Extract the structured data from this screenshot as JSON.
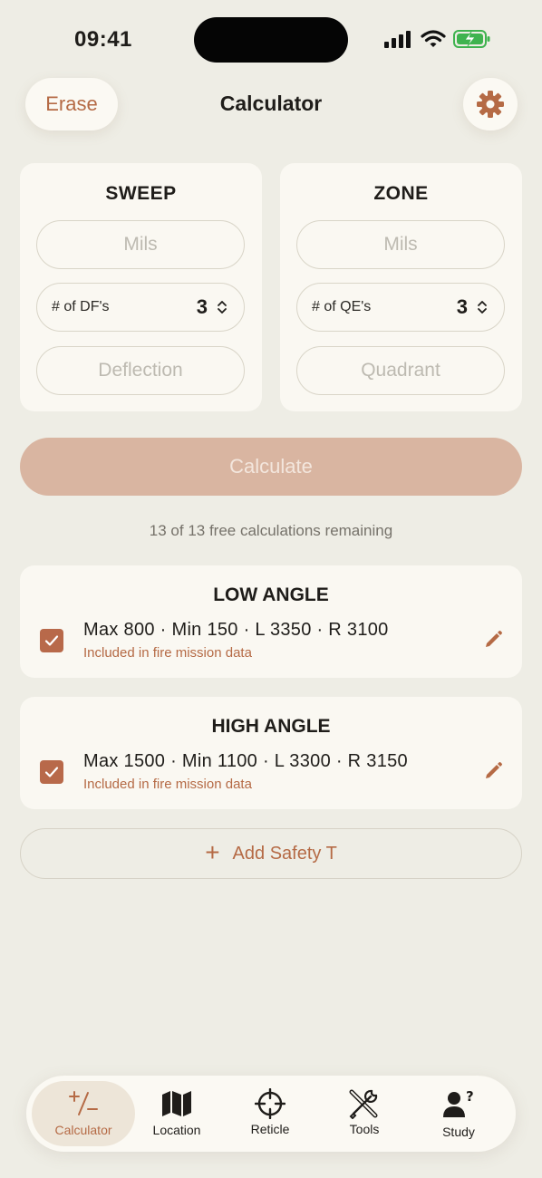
{
  "status": {
    "time": "09:41"
  },
  "header": {
    "erase_label": "Erase",
    "title": "Calculator"
  },
  "sweep": {
    "title": "SWEEP",
    "mils_placeholder": "Mils",
    "stepper_label": "# of DF's",
    "stepper_value": "3",
    "deflection_placeholder": "Deflection"
  },
  "zone": {
    "title": "ZONE",
    "mils_placeholder": "Mils",
    "stepper_label": "# of QE's",
    "stepper_value": "3",
    "quadrant_placeholder": "Quadrant"
  },
  "calculate_label": "Calculate",
  "remaining_text": "13 of 13 free calculations remaining",
  "safety": [
    {
      "title": "LOW ANGLE",
      "values": "Max 800 · Min 150 · L 3350 · R 3100",
      "note": "Included in fire mission data",
      "checked": true
    },
    {
      "title": "HIGH ANGLE",
      "values": "Max 1500 · Min 1100 · L 3300 · R 3150",
      "note": "Included in fire mission data",
      "checked": true
    }
  ],
  "add_safety_label": "Add Safety T",
  "tabs": [
    {
      "label": "Calculator",
      "icon": "plus-minus-icon",
      "active": true
    },
    {
      "label": "Location",
      "icon": "map-icon"
    },
    {
      "label": "Reticle",
      "icon": "crosshair-icon"
    },
    {
      "label": "Tools",
      "icon": "tools-icon"
    },
    {
      "label": "Study",
      "icon": "person-question-icon"
    }
  ],
  "colors": {
    "accent": "#b56a45",
    "background": "#eeede5",
    "card": "#faf8f2",
    "button_disabled": "#d9b5a1"
  }
}
